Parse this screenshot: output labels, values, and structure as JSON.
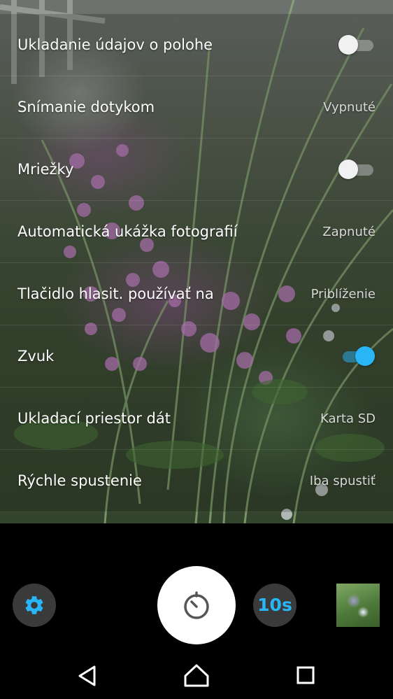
{
  "settings": [
    {
      "label": "Ukladanie údajov o polohe",
      "type": "toggle",
      "on": false
    },
    {
      "label": "Snímanie dotykom",
      "type": "value",
      "value": "Vypnuté"
    },
    {
      "label": "Mriežky",
      "type": "toggle",
      "on": false
    },
    {
      "label": "Automatická ukážka fotografií",
      "type": "value",
      "value": "Zapnuté"
    },
    {
      "label": "Tlačidlo hlasit. používať na",
      "type": "value",
      "value": "Priblíženie"
    },
    {
      "label": "Zvuk",
      "type": "toggle",
      "on": true
    },
    {
      "label": "Ukladací priestor dát",
      "type": "value",
      "value": "Karta SD"
    },
    {
      "label": "Rýchle spustenie",
      "type": "value",
      "value": "Iba spustiť"
    }
  ],
  "controls": {
    "timer_label": "10s",
    "settings_icon": "gear-icon",
    "shutter_icon": "self-timer-icon",
    "accent_color": "#29b6f6"
  },
  "nav": {
    "back_icon": "back-triangle-icon",
    "home_icon": "home-icon",
    "recents_icon": "recents-square-icon"
  }
}
